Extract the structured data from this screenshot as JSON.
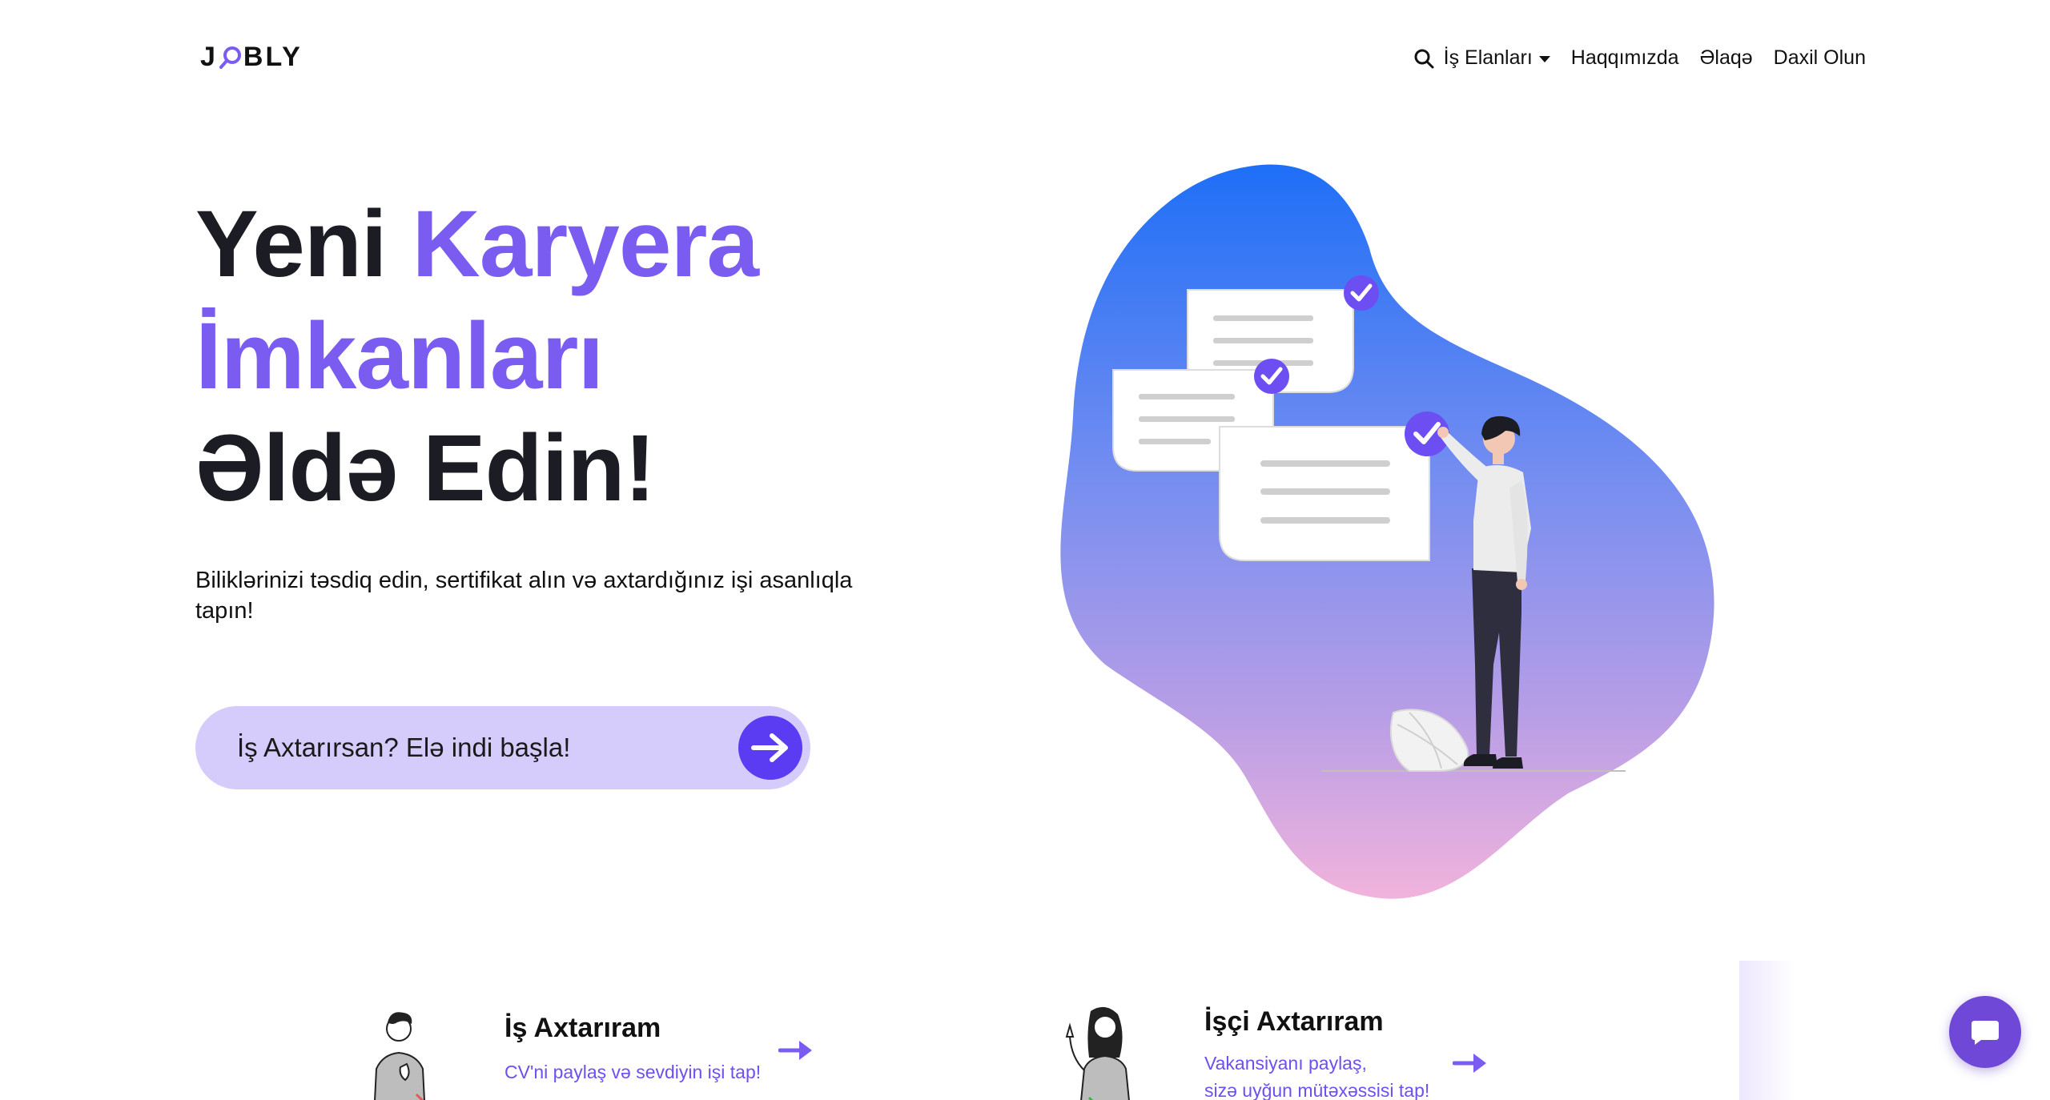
{
  "brand": {
    "logo_prefix": "J",
    "logo_suffix": "BLY",
    "accent_color": "#7b5cf0",
    "primary_color": "#5b3cf2"
  },
  "nav": {
    "search_icon": "search-icon",
    "items": [
      {
        "label": "İş Elanları",
        "has_dropdown": true
      },
      {
        "label": "Haqqımızda"
      },
      {
        "label": "Əlaqə"
      },
      {
        "label": "Daxil Olun"
      }
    ]
  },
  "hero": {
    "title_word1": "Yeni",
    "title_word2": "Karyera",
    "title_line2": "İmkanları",
    "title_line3": "Əldə Edin!",
    "subtitle": "Biliklərinizi təsdiq edin, sertifikat alın və axtardığınız işi asanlıqla tapın!",
    "cta_label": "İş Axtarırsan? Elə indi başla!"
  },
  "cards": [
    {
      "title": "İş Axtarıram",
      "desc_line1": "CV'ni paylaş və sevdiyin işi tap!",
      "desc_line2": ""
    },
    {
      "title": "İşçi Axtarıram",
      "desc_line1": "Vakansiyanı paylaş,",
      "desc_line2": "sizə uyğun mütəxəssisi tap!"
    }
  ],
  "chat": {
    "icon": "chat-icon"
  }
}
